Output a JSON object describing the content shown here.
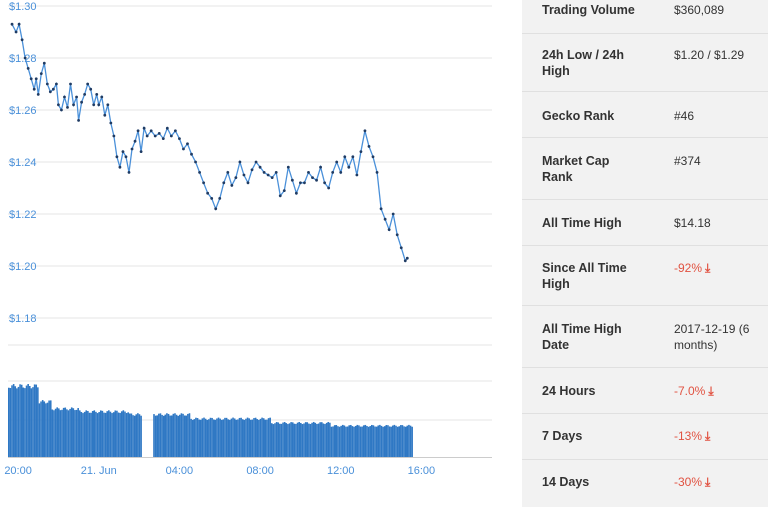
{
  "chart_data": {
    "type": "line",
    "y_ticks": [
      "$1.30",
      "$1.28",
      "$1.26",
      "$1.24",
      "$1.22",
      "$1.20",
      "$1.18"
    ],
    "ylim": [
      1.18,
      1.3
    ],
    "x_ticks": [
      "20:00",
      "21. Jun",
      "04:00",
      "08:00",
      "12:00",
      "16:00"
    ],
    "x_tick_hours": [
      0,
      4,
      8,
      12,
      16,
      20
    ],
    "x_range_hours": [
      -0.5,
      23.5
    ],
    "price_series": [
      [
        -0.3,
        1.293
      ],
      [
        -0.1,
        1.29
      ],
      [
        0.05,
        1.293
      ],
      [
        0.2,
        1.287
      ],
      [
        0.35,
        1.28
      ],
      [
        0.5,
        1.276
      ],
      [
        0.65,
        1.272
      ],
      [
        0.8,
        1.268
      ],
      [
        0.9,
        1.272
      ],
      [
        1.0,
        1.266
      ],
      [
        1.15,
        1.274
      ],
      [
        1.3,
        1.278
      ],
      [
        1.45,
        1.27
      ],
      [
        1.6,
        1.267
      ],
      [
        1.75,
        1.268
      ],
      [
        1.9,
        1.27
      ],
      [
        2.0,
        1.262
      ],
      [
        2.15,
        1.26
      ],
      [
        2.3,
        1.265
      ],
      [
        2.45,
        1.261
      ],
      [
        2.6,
        1.27
      ],
      [
        2.75,
        1.262
      ],
      [
        2.9,
        1.265
      ],
      [
        3.0,
        1.256
      ],
      [
        3.15,
        1.263
      ],
      [
        3.3,
        1.266
      ],
      [
        3.45,
        1.27
      ],
      [
        3.6,
        1.268
      ],
      [
        3.75,
        1.262
      ],
      [
        3.9,
        1.266
      ],
      [
        4.0,
        1.262
      ],
      [
        4.15,
        1.265
      ],
      [
        4.3,
        1.258
      ],
      [
        4.45,
        1.262
      ],
      [
        4.6,
        1.255
      ],
      [
        4.75,
        1.25
      ],
      [
        4.9,
        1.242
      ],
      [
        5.05,
        1.238
      ],
      [
        5.2,
        1.244
      ],
      [
        5.35,
        1.242
      ],
      [
        5.5,
        1.236
      ],
      [
        5.65,
        1.245
      ],
      [
        5.8,
        1.248
      ],
      [
        5.95,
        1.252
      ],
      [
        6.1,
        1.244
      ],
      [
        6.25,
        1.253
      ],
      [
        6.4,
        1.25
      ],
      [
        6.6,
        1.252
      ],
      [
        6.8,
        1.25
      ],
      [
        7.0,
        1.251
      ],
      [
        7.2,
        1.249
      ],
      [
        7.4,
        1.253
      ],
      [
        7.6,
        1.25
      ],
      [
        7.8,
        1.252
      ],
      [
        8.0,
        1.249
      ],
      [
        8.2,
        1.245
      ],
      [
        8.4,
        1.247
      ],
      [
        8.6,
        1.243
      ],
      [
        8.8,
        1.24
      ],
      [
        9.0,
        1.236
      ],
      [
        9.2,
        1.232
      ],
      [
        9.4,
        1.228
      ],
      [
        9.6,
        1.226
      ],
      [
        9.8,
        1.222
      ],
      [
        10.0,
        1.226
      ],
      [
        10.2,
        1.232
      ],
      [
        10.4,
        1.236
      ],
      [
        10.6,
        1.231
      ],
      [
        10.8,
        1.234
      ],
      [
        11.0,
        1.24
      ],
      [
        11.2,
        1.235
      ],
      [
        11.4,
        1.232
      ],
      [
        11.6,
        1.237
      ],
      [
        11.8,
        1.24
      ],
      [
        12.0,
        1.238
      ],
      [
        12.2,
        1.236
      ],
      [
        12.4,
        1.235
      ],
      [
        12.6,
        1.234
      ],
      [
        12.8,
        1.236
      ],
      [
        13.0,
        1.227
      ],
      [
        13.2,
        1.229
      ],
      [
        13.4,
        1.238
      ],
      [
        13.6,
        1.233
      ],
      [
        13.8,
        1.228
      ],
      [
        14.0,
        1.232
      ],
      [
        14.2,
        1.232
      ],
      [
        14.4,
        1.236
      ],
      [
        14.6,
        1.234
      ],
      [
        14.8,
        1.233
      ],
      [
        15.0,
        1.238
      ],
      [
        15.2,
        1.232
      ],
      [
        15.4,
        1.23
      ],
      [
        15.6,
        1.236
      ],
      [
        15.8,
        1.24
      ],
      [
        16.0,
        1.236
      ],
      [
        16.2,
        1.242
      ],
      [
        16.4,
        1.238
      ],
      [
        16.6,
        1.242
      ],
      [
        16.8,
        1.235
      ],
      [
        17.0,
        1.244
      ],
      [
        17.2,
        1.252
      ],
      [
        17.4,
        1.246
      ],
      [
        17.6,
        1.242
      ],
      [
        17.8,
        1.236
      ],
      [
        18.0,
        1.222
      ],
      [
        18.2,
        1.218
      ],
      [
        18.4,
        1.214
      ],
      [
        18.6,
        1.22
      ],
      [
        18.8,
        1.212
      ],
      [
        19.0,
        1.207
      ],
      [
        19.2,
        1.202
      ],
      [
        19.3,
        1.203
      ]
    ],
    "volume_series": {
      "start_hour": -0.5,
      "step_hours": 0.08,
      "gap_hours": [
        6.1,
        6.7
      ],
      "levels": [
        {
          "to_hour": 1.0,
          "value": 1.0
        },
        {
          "to_hour": 1.6,
          "value": 0.78
        },
        {
          "to_hour": 3.0,
          "value": 0.68
        },
        {
          "to_hour": 5.5,
          "value": 0.64
        },
        {
          "to_hour": 8.5,
          "value": 0.6
        },
        {
          "to_hour": 12.5,
          "value": 0.54
        },
        {
          "to_hour": 15.5,
          "value": 0.48
        },
        {
          "to_hour": 19.5,
          "value": 0.44
        }
      ]
    }
  },
  "stats": [
    {
      "label": "Trading Volume",
      "value": "$360,089",
      "negative": false
    },
    {
      "label": "24h Low / 24h High",
      "value": "$1.20 / $1.29",
      "negative": false
    },
    {
      "label": "Gecko Rank",
      "value": "#46",
      "negative": false
    },
    {
      "label": "Market Cap Rank",
      "value": "#374",
      "negative": false
    },
    {
      "label": "All Time High",
      "value": "$14.18",
      "negative": false
    },
    {
      "label": "Since All Time High",
      "value": "-92%",
      "negative": true
    },
    {
      "label": "All Time High Date",
      "value": "2017-12-19 (6 months)",
      "negative": false
    },
    {
      "label": "24 Hours",
      "value": "-7.0%",
      "negative": true
    },
    {
      "label": "7 Days",
      "value": "-13%",
      "negative": true
    },
    {
      "label": "14 Days",
      "value": "-30%",
      "negative": true
    }
  ],
  "colors": {
    "line": "#4a90d9",
    "marker": "#1f3b63",
    "bar": "#2f78c4",
    "grid": "#e6e6e6",
    "negative": "#e15241",
    "panel_bg": "#f2f2f2"
  },
  "icons": {
    "negative_change": "arrow-down-icon"
  }
}
